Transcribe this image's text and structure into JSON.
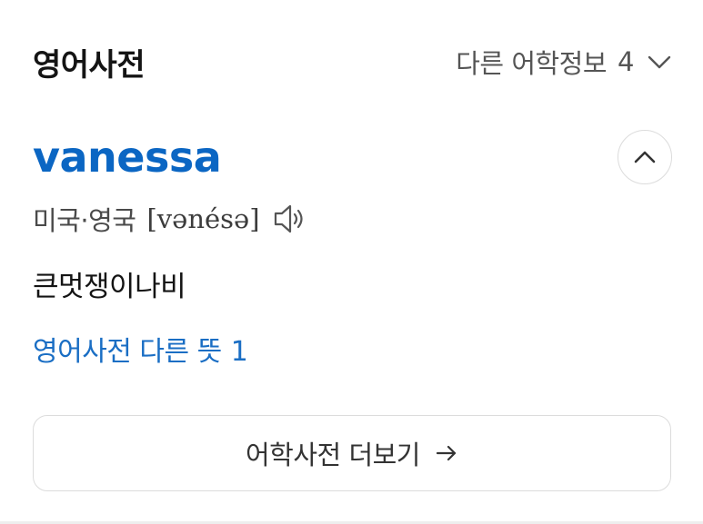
{
  "header": {
    "title": "영어사전",
    "other_info_label": "다른 어학정보",
    "other_info_count": "4",
    "expand_icon": "chevron-down-icon"
  },
  "entry": {
    "headword": "vanessa",
    "collapse_icon": "chevron-up-icon",
    "pronunciation_region": "미국·영국",
    "pronunciation": "[vənésə]",
    "audio_icon": "speaker-icon",
    "meaning": "큰멋쟁이나비",
    "other_meanings_label": "영어사전 다른 뜻",
    "other_meanings_count": "1"
  },
  "footer": {
    "more_label": "어학사전 더보기",
    "more_icon": "arrow-right-icon"
  },
  "colors": {
    "headword": "#0b66c3",
    "link": "#1a6ec4",
    "border": "#dcdcdc"
  }
}
